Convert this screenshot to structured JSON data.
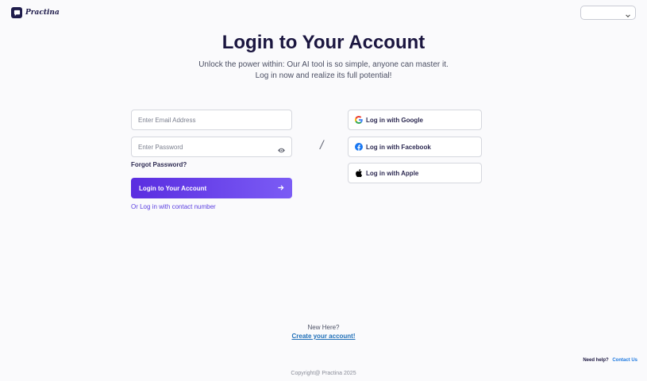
{
  "brand": {
    "name": "Practina",
    "color": "#1e1b4b"
  },
  "accent_colors": {
    "primary_gradient_start": "#5a2de0",
    "primary_gradient_end": "#7b5cf5",
    "link": "#1f6fb8"
  },
  "language_select": {
    "value": ""
  },
  "main": {
    "title": "Login to Your Account",
    "subtitle_line1": "Unlock the power within: Our AI tool is so simple, anyone can master it.",
    "subtitle_line2": "Log in now and realize its full potential!"
  },
  "form": {
    "email_placeholder": "Enter Email Address",
    "email_value": "",
    "password_placeholder": "Enter Password",
    "password_value": "",
    "forgot_label": "Forgot Password?",
    "submit_label": "Login to Your Account",
    "alt_login_label": "Or Log in with contact number"
  },
  "divider": "/",
  "social": [
    {
      "label": "Log in with Google",
      "icon": "google-icon"
    },
    {
      "label": "Log in with Facebook",
      "icon": "facebook-icon"
    },
    {
      "label": "Log in with Apple",
      "icon": "apple-icon"
    }
  ],
  "signup": {
    "prompt": "New Here?",
    "link_label": "Create your account!"
  },
  "help": {
    "prompt": "Need help?",
    "link_label": "Contact Us"
  },
  "copyright": "Copyright@ Practina 2025"
}
